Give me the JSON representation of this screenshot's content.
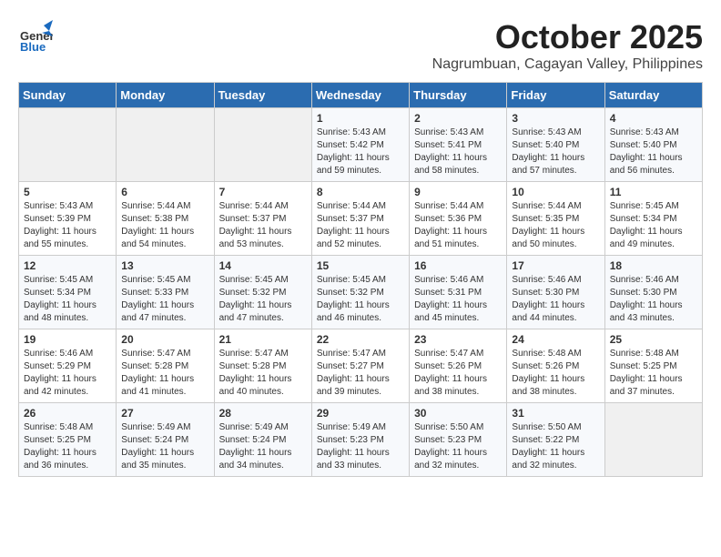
{
  "header": {
    "logo_general": "General",
    "logo_blue": "Blue",
    "month": "October 2025",
    "location": "Nagrumbuan, Cagayan Valley, Philippines"
  },
  "weekdays": [
    "Sunday",
    "Monday",
    "Tuesday",
    "Wednesday",
    "Thursday",
    "Friday",
    "Saturday"
  ],
  "weeks": [
    [
      {
        "day": "",
        "sunrise": "",
        "sunset": "",
        "daylight": "",
        "empty": true
      },
      {
        "day": "",
        "sunrise": "",
        "sunset": "",
        "daylight": "",
        "empty": true
      },
      {
        "day": "",
        "sunrise": "",
        "sunset": "",
        "daylight": "",
        "empty": true
      },
      {
        "day": "1",
        "sunrise": "Sunrise: 5:43 AM",
        "sunset": "Sunset: 5:42 PM",
        "daylight": "Daylight: 11 hours and 59 minutes.",
        "empty": false
      },
      {
        "day": "2",
        "sunrise": "Sunrise: 5:43 AM",
        "sunset": "Sunset: 5:41 PM",
        "daylight": "Daylight: 11 hours and 58 minutes.",
        "empty": false
      },
      {
        "day": "3",
        "sunrise": "Sunrise: 5:43 AM",
        "sunset": "Sunset: 5:40 PM",
        "daylight": "Daylight: 11 hours and 57 minutes.",
        "empty": false
      },
      {
        "day": "4",
        "sunrise": "Sunrise: 5:43 AM",
        "sunset": "Sunset: 5:40 PM",
        "daylight": "Daylight: 11 hours and 56 minutes.",
        "empty": false
      }
    ],
    [
      {
        "day": "5",
        "sunrise": "Sunrise: 5:43 AM",
        "sunset": "Sunset: 5:39 PM",
        "daylight": "Daylight: 11 hours and 55 minutes.",
        "empty": false
      },
      {
        "day": "6",
        "sunrise": "Sunrise: 5:44 AM",
        "sunset": "Sunset: 5:38 PM",
        "daylight": "Daylight: 11 hours and 54 minutes.",
        "empty": false
      },
      {
        "day": "7",
        "sunrise": "Sunrise: 5:44 AM",
        "sunset": "Sunset: 5:37 PM",
        "daylight": "Daylight: 11 hours and 53 minutes.",
        "empty": false
      },
      {
        "day": "8",
        "sunrise": "Sunrise: 5:44 AM",
        "sunset": "Sunset: 5:37 PM",
        "daylight": "Daylight: 11 hours and 52 minutes.",
        "empty": false
      },
      {
        "day": "9",
        "sunrise": "Sunrise: 5:44 AM",
        "sunset": "Sunset: 5:36 PM",
        "daylight": "Daylight: 11 hours and 51 minutes.",
        "empty": false
      },
      {
        "day": "10",
        "sunrise": "Sunrise: 5:44 AM",
        "sunset": "Sunset: 5:35 PM",
        "daylight": "Daylight: 11 hours and 50 minutes.",
        "empty": false
      },
      {
        "day": "11",
        "sunrise": "Sunrise: 5:45 AM",
        "sunset": "Sunset: 5:34 PM",
        "daylight": "Daylight: 11 hours and 49 minutes.",
        "empty": false
      }
    ],
    [
      {
        "day": "12",
        "sunrise": "Sunrise: 5:45 AM",
        "sunset": "Sunset: 5:34 PM",
        "daylight": "Daylight: 11 hours and 48 minutes.",
        "empty": false
      },
      {
        "day": "13",
        "sunrise": "Sunrise: 5:45 AM",
        "sunset": "Sunset: 5:33 PM",
        "daylight": "Daylight: 11 hours and 47 minutes.",
        "empty": false
      },
      {
        "day": "14",
        "sunrise": "Sunrise: 5:45 AM",
        "sunset": "Sunset: 5:32 PM",
        "daylight": "Daylight: 11 hours and 47 minutes.",
        "empty": false
      },
      {
        "day": "15",
        "sunrise": "Sunrise: 5:45 AM",
        "sunset": "Sunset: 5:32 PM",
        "daylight": "Daylight: 11 hours and 46 minutes.",
        "empty": false
      },
      {
        "day": "16",
        "sunrise": "Sunrise: 5:46 AM",
        "sunset": "Sunset: 5:31 PM",
        "daylight": "Daylight: 11 hours and 45 minutes.",
        "empty": false
      },
      {
        "day": "17",
        "sunrise": "Sunrise: 5:46 AM",
        "sunset": "Sunset: 5:30 PM",
        "daylight": "Daylight: 11 hours and 44 minutes.",
        "empty": false
      },
      {
        "day": "18",
        "sunrise": "Sunrise: 5:46 AM",
        "sunset": "Sunset: 5:30 PM",
        "daylight": "Daylight: 11 hours and 43 minutes.",
        "empty": false
      }
    ],
    [
      {
        "day": "19",
        "sunrise": "Sunrise: 5:46 AM",
        "sunset": "Sunset: 5:29 PM",
        "daylight": "Daylight: 11 hours and 42 minutes.",
        "empty": false
      },
      {
        "day": "20",
        "sunrise": "Sunrise: 5:47 AM",
        "sunset": "Sunset: 5:28 PM",
        "daylight": "Daylight: 11 hours and 41 minutes.",
        "empty": false
      },
      {
        "day": "21",
        "sunrise": "Sunrise: 5:47 AM",
        "sunset": "Sunset: 5:28 PM",
        "daylight": "Daylight: 11 hours and 40 minutes.",
        "empty": false
      },
      {
        "day": "22",
        "sunrise": "Sunrise: 5:47 AM",
        "sunset": "Sunset: 5:27 PM",
        "daylight": "Daylight: 11 hours and 39 minutes.",
        "empty": false
      },
      {
        "day": "23",
        "sunrise": "Sunrise: 5:47 AM",
        "sunset": "Sunset: 5:26 PM",
        "daylight": "Daylight: 11 hours and 38 minutes.",
        "empty": false
      },
      {
        "day": "24",
        "sunrise": "Sunrise: 5:48 AM",
        "sunset": "Sunset: 5:26 PM",
        "daylight": "Daylight: 11 hours and 38 minutes.",
        "empty": false
      },
      {
        "day": "25",
        "sunrise": "Sunrise: 5:48 AM",
        "sunset": "Sunset: 5:25 PM",
        "daylight": "Daylight: 11 hours and 37 minutes.",
        "empty": false
      }
    ],
    [
      {
        "day": "26",
        "sunrise": "Sunrise: 5:48 AM",
        "sunset": "Sunset: 5:25 PM",
        "daylight": "Daylight: 11 hours and 36 minutes.",
        "empty": false
      },
      {
        "day": "27",
        "sunrise": "Sunrise: 5:49 AM",
        "sunset": "Sunset: 5:24 PM",
        "daylight": "Daylight: 11 hours and 35 minutes.",
        "empty": false
      },
      {
        "day": "28",
        "sunrise": "Sunrise: 5:49 AM",
        "sunset": "Sunset: 5:24 PM",
        "daylight": "Daylight: 11 hours and 34 minutes.",
        "empty": false
      },
      {
        "day": "29",
        "sunrise": "Sunrise: 5:49 AM",
        "sunset": "Sunset: 5:23 PM",
        "daylight": "Daylight: 11 hours and 33 minutes.",
        "empty": false
      },
      {
        "day": "30",
        "sunrise": "Sunrise: 5:50 AM",
        "sunset": "Sunset: 5:23 PM",
        "daylight": "Daylight: 11 hours and 32 minutes.",
        "empty": false
      },
      {
        "day": "31",
        "sunrise": "Sunrise: 5:50 AM",
        "sunset": "Sunset: 5:22 PM",
        "daylight": "Daylight: 11 hours and 32 minutes.",
        "empty": false
      },
      {
        "day": "",
        "sunrise": "",
        "sunset": "",
        "daylight": "",
        "empty": true
      }
    ]
  ]
}
